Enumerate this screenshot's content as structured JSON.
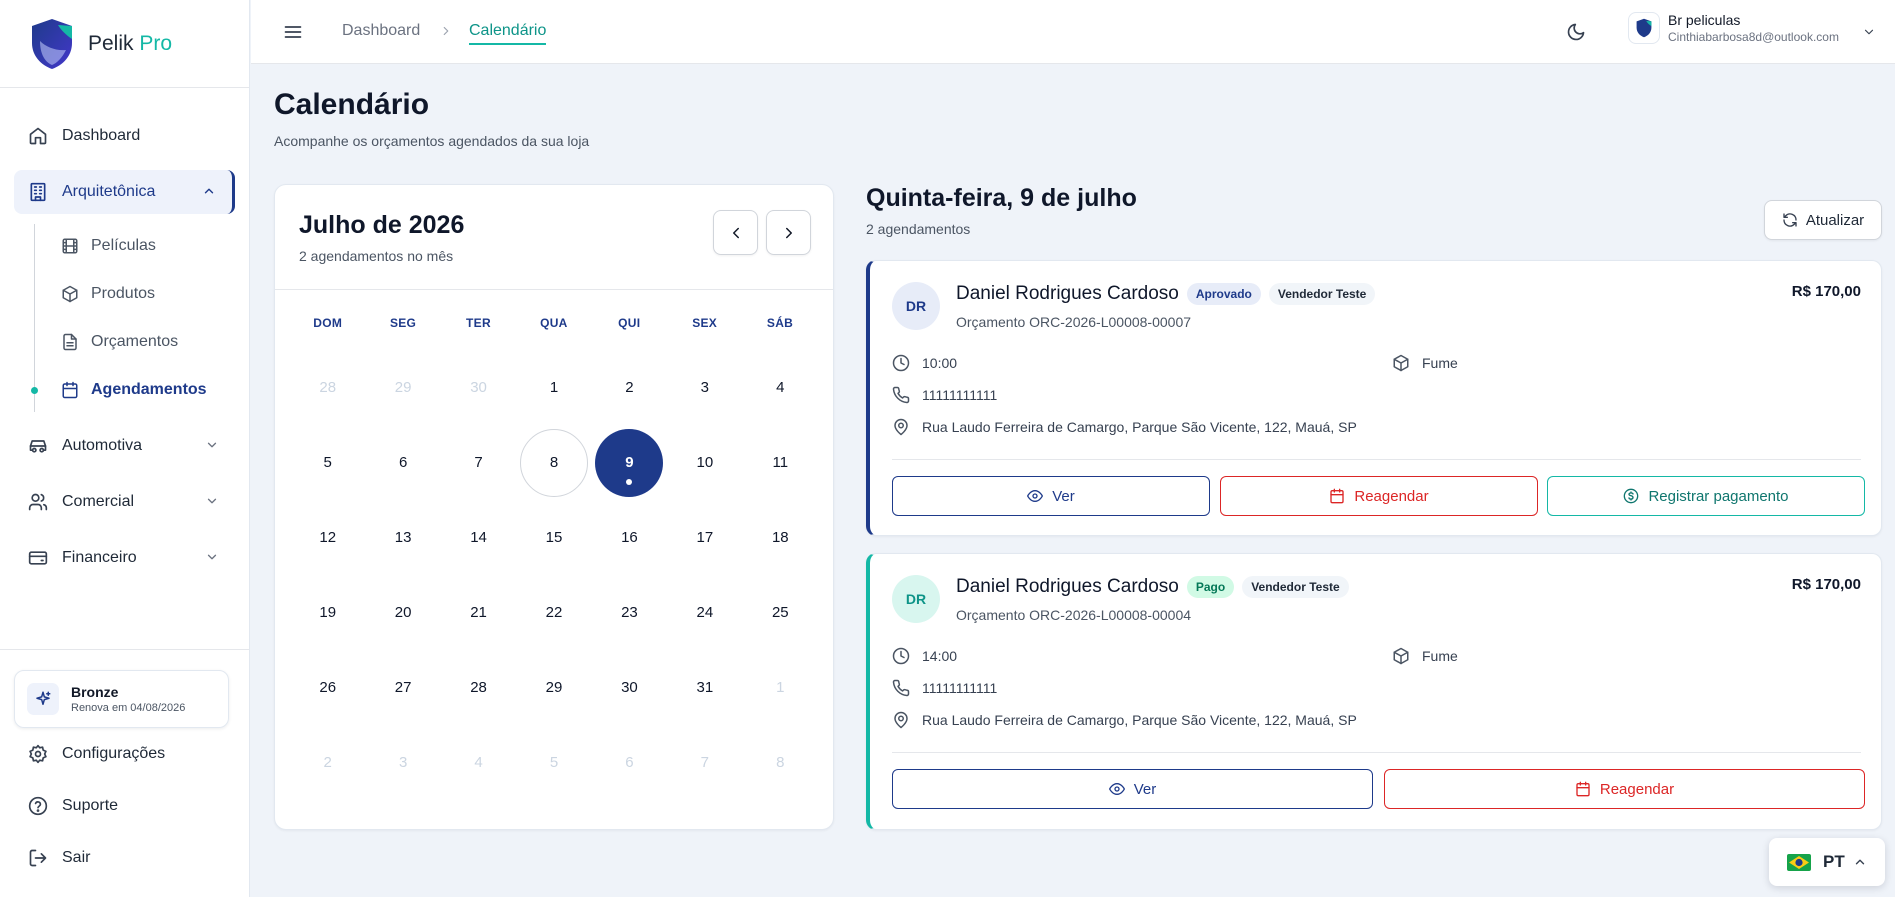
{
  "brand": {
    "name": "Pelik",
    "suffix": "Pro"
  },
  "colors": {
    "primary": "#1e3a8a",
    "accent": "#14b8a6",
    "danger": "#dc2626",
    "background": "#eff3f9"
  },
  "sidebar": {
    "items": [
      {
        "label": "Dashboard",
        "icon": "home-icon"
      },
      {
        "label": "Arquitetônica",
        "icon": "building-icon",
        "expanded": true,
        "children": [
          {
            "label": "Películas",
            "icon": "film-icon"
          },
          {
            "label": "Produtos",
            "icon": "box-icon"
          },
          {
            "label": "Orçamentos",
            "icon": "document-icon"
          },
          {
            "label": "Agendamentos",
            "icon": "calendar-icon",
            "active": true
          }
        ]
      },
      {
        "label": "Automotiva",
        "icon": "car-icon"
      },
      {
        "label": "Comercial",
        "icon": "users-icon"
      },
      {
        "label": "Financeiro",
        "icon": "wallet-icon"
      }
    ],
    "plan": {
      "name": "Bronze",
      "renews": "Renova em 04/08/2026"
    },
    "bottom": [
      {
        "label": "Configurações",
        "icon": "gear-icon"
      },
      {
        "label": "Suporte",
        "icon": "help-icon"
      },
      {
        "label": "Sair",
        "icon": "logout-icon"
      }
    ]
  },
  "topbar": {
    "breadcrumb": {
      "home": "Dashboard",
      "current": "Calendário"
    },
    "user": {
      "name": "Br peliculas",
      "email": "Cinthiabarbosa8d@outlook.com"
    }
  },
  "page": {
    "title": "Calendário",
    "subtitle": "Acompanhe os orçamentos agendados da sua loja"
  },
  "calendar": {
    "month": "Julho de 2026",
    "count": "2 agendamentos no mês",
    "weekdays": [
      "DOM",
      "SEG",
      "TER",
      "QUA",
      "QUI",
      "SEX",
      "SÁB"
    ],
    "days": [
      {
        "n": "28",
        "muted": true
      },
      {
        "n": "29",
        "muted": true
      },
      {
        "n": "30",
        "muted": true
      },
      {
        "n": "1"
      },
      {
        "n": "2"
      },
      {
        "n": "3"
      },
      {
        "n": "4"
      },
      {
        "n": "5"
      },
      {
        "n": "6"
      },
      {
        "n": "7"
      },
      {
        "n": "8",
        "today": true
      },
      {
        "n": "9",
        "selected": true,
        "event": true
      },
      {
        "n": "10"
      },
      {
        "n": "11"
      },
      {
        "n": "12"
      },
      {
        "n": "13"
      },
      {
        "n": "14"
      },
      {
        "n": "15"
      },
      {
        "n": "16"
      },
      {
        "n": "17"
      },
      {
        "n": "18"
      },
      {
        "n": "19"
      },
      {
        "n": "20"
      },
      {
        "n": "21"
      },
      {
        "n": "22"
      },
      {
        "n": "23"
      },
      {
        "n": "24"
      },
      {
        "n": "25"
      },
      {
        "n": "26"
      },
      {
        "n": "27"
      },
      {
        "n": "28"
      },
      {
        "n": "29"
      },
      {
        "n": "30"
      },
      {
        "n": "31"
      },
      {
        "n": "1",
        "muted": true
      },
      {
        "n": "2",
        "muted": true
      },
      {
        "n": "3",
        "muted": true
      },
      {
        "n": "4",
        "muted": true
      },
      {
        "n": "5",
        "muted": true
      },
      {
        "n": "6",
        "muted": true
      },
      {
        "n": "7",
        "muted": true
      },
      {
        "n": "8",
        "muted": true
      }
    ]
  },
  "day_panel": {
    "title": "Quinta-feira, 9 de julho",
    "count": "2 agendamentos",
    "refresh_label": "Atualizar"
  },
  "appointments": [
    {
      "initials": "DR",
      "customer": "Daniel Rodrigues Cardoso",
      "status": "Aprovado",
      "seller": "Vendedor Teste",
      "quote": "Orçamento ORC-2026-L00008-00007",
      "price": "R$ 170,00",
      "time": "10:00",
      "phone": "11111111111",
      "address": "Rua Laudo Ferreira de Camargo, Parque São Vicente, 122, Mauá, SP",
      "film": "Fume",
      "view_label": "Ver",
      "reschedule_label": "Reagendar",
      "pay_label": "Registrar pagamento"
    },
    {
      "initials": "DR",
      "customer": "Daniel Rodrigues Cardoso",
      "status": "Pago",
      "seller": "Vendedor Teste",
      "quote": "Orçamento ORC-2026-L00008-00004",
      "price": "R$ 170,00",
      "time": "14:00",
      "phone": "11111111111",
      "address": "Rua Laudo Ferreira de Camargo, Parque São Vicente, 122, Mauá, SP",
      "film": "Fume",
      "view_label": "Ver",
      "reschedule_label": "Reagendar"
    }
  ],
  "language": {
    "code": "PT",
    "flag": "brazil-flag-icon"
  }
}
